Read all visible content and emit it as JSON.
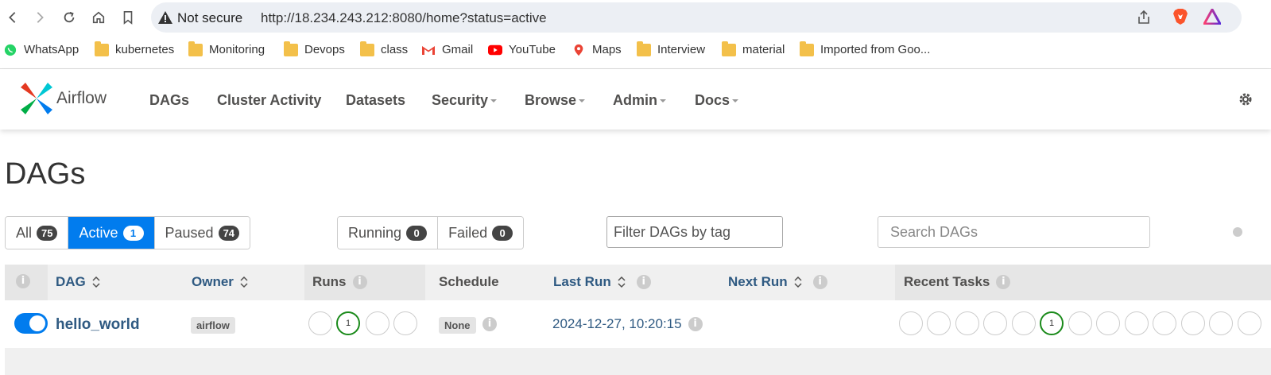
{
  "browser": {
    "security_label": "Not secure",
    "url": "http://18.234.243.212:8080/home?status=active"
  },
  "bookmarks": [
    "WhatsApp",
    "kubernetes",
    "Monitoring",
    "Devops",
    "class",
    "Gmail",
    "YouTube",
    "Maps",
    "Interview",
    "material",
    "Imported from Goo..."
  ],
  "airflow_nav": {
    "brand": "Airflow",
    "items": [
      "DAGs",
      "Cluster Activity",
      "Datasets",
      "Security",
      "Browse",
      "Admin",
      "Docs"
    ]
  },
  "page": {
    "title": "DAGs",
    "status_filters": [
      {
        "label": "All",
        "count": "75"
      },
      {
        "label": "Active",
        "count": "1"
      },
      {
        "label": "Paused",
        "count": "74"
      }
    ],
    "run_filters": [
      {
        "label": "Running",
        "count": "0"
      },
      {
        "label": "Failed",
        "count": "0"
      }
    ],
    "tag_filter_placeholder": "Filter DAGs by tag",
    "search_placeholder": "Search DAGs"
  },
  "table": {
    "headers": [
      "DAG",
      "Owner",
      "Runs",
      "Schedule",
      "Last Run",
      "Next Run",
      "Recent Tasks"
    ],
    "rows": [
      {
        "dag": "hello_world",
        "owner": "airflow",
        "runs_success": "1",
        "schedule": "None",
        "last_run": "2024-12-27, 10:20:15",
        "recent_tasks_success": "1"
      }
    ]
  },
  "colors": {
    "accent": "#017cee",
    "success": "#1a8a1a",
    "link": "#2f5a82"
  }
}
